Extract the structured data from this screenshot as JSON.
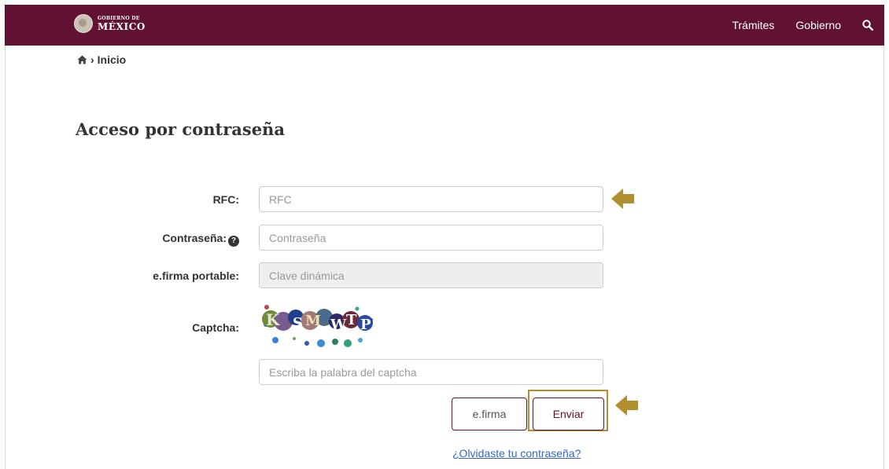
{
  "header": {
    "logo_line1": "GOBIERNO DE",
    "logo_line2": "MÉXICO",
    "nav": [
      {
        "label": "Trámites"
      },
      {
        "label": "Gobierno"
      }
    ]
  },
  "breadcrumb": {
    "separator": "›",
    "current": "Inicio"
  },
  "page": {
    "title": "Acceso por contraseña"
  },
  "form": {
    "rfc": {
      "label": "RFC:",
      "placeholder": "RFC"
    },
    "password": {
      "label": "Contraseña:",
      "placeholder": "Contraseña"
    },
    "efirma_portable": {
      "label": "e.firma portable:",
      "placeholder": "Clave dinámica"
    },
    "captcha": {
      "label": "Captcha:",
      "text": "KSMWTP",
      "placeholder": "Escriba la palabra del captcha"
    },
    "buttons": {
      "efirma": "e.firma",
      "enviar": "Enviar"
    },
    "forgot_link": "¿Olvidaste tu contraseña?"
  },
  "colors": {
    "header_bg": "#611232",
    "highlight": "#b38e2f"
  },
  "icons": {
    "home": "home-icon",
    "search": "search-icon",
    "help": "question-circle-icon",
    "arrow": "arrow-left-icon"
  }
}
